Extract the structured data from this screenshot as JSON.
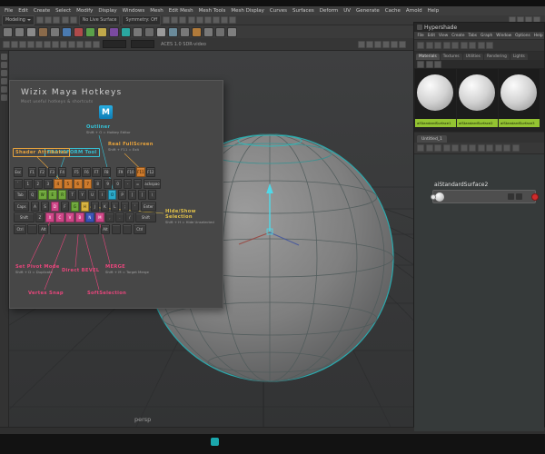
{
  "accent_colors": {
    "wireframe_teal": "#2aa9ad",
    "manipulator_cyan": "#4fd8e8",
    "swatch_label_green": "#93c332",
    "port_red": "#cf2b2b",
    "bottom_accent_teal": "#1ba7ad",
    "hotkey_cyan": "#35c1d6",
    "hotkey_orange": "#e8a33c",
    "hotkey_yellow": "#e3c248",
    "hotkey_magenta": "#e8467c"
  },
  "menubar": {
    "items": [
      "File",
      "Edit",
      "Create",
      "Select",
      "Modify",
      "Display",
      "Windows",
      "Mesh",
      "Edit Mesh",
      "Mesh Tools",
      "Mesh Display",
      "Curves",
      "Surfaces",
      "Deform",
      "UV",
      "Generate",
      "Cache",
      "Arnold",
      "Help"
    ]
  },
  "statusline": {
    "menu_set": "Modeling",
    "live_surface": "No Live Surface",
    "symmetry": "Symmetry: Off",
    "file_icons": [
      "new-scene-icon",
      "open-scene-icon",
      "save-scene-icon"
    ],
    "history_icons": [
      "undo-icon",
      "redo-icon"
    ],
    "mask_icons": [
      "select-hierarchy-icon",
      "select-object-icon",
      "select-component-icon"
    ],
    "snap_icons": [
      "snap-grid-icon",
      "snap-curve-icon",
      "snap-point-icon",
      "snap-projected-center-icon",
      "snap-view-plane-icon",
      "make-live-icon"
    ],
    "right_icons": [
      "construction-history-icon",
      "render-view-icon",
      "ipr-render-icon",
      "render-settings-icon"
    ]
  },
  "shelf": {
    "icons": [
      {
        "name": "poly-sphere-icon",
        "color": "#787878"
      },
      {
        "name": "poly-cube-icon",
        "color": "#787878"
      },
      {
        "name": "poly-cylinder-icon",
        "color": "#8a8a8a"
      },
      {
        "name": "poly-plane-icon",
        "color": "#8a6a4a"
      },
      {
        "name": "poly-torus-icon",
        "color": "#787878"
      },
      {
        "name": "poly-cone-icon",
        "color": "#4a7ab0"
      },
      {
        "name": "poly-disc-icon",
        "color": "#b04a4a"
      },
      {
        "name": "poly-gear-icon",
        "color": "#5aa04a"
      },
      {
        "name": "poly-soccerball-icon",
        "color": "#c0a84a"
      },
      {
        "name": "poly-platonic-icon",
        "color": "#7a4aa0"
      },
      {
        "name": "poly-superellipse-icon",
        "color": "#2aa7a0"
      },
      {
        "name": "poly-helix-icon",
        "color": "#787878"
      },
      {
        "name": "poly-pipe-icon",
        "color": "#6a6a6a"
      },
      {
        "name": "poly-prism-icon",
        "color": "#9a9a9a"
      },
      {
        "name": "poly-pyramid-icon",
        "color": "#6a8a9a"
      },
      {
        "name": "nurbs-sphere-icon",
        "color": "#787878"
      },
      {
        "name": "nurbs-cube-icon",
        "color": "#b07a3a"
      },
      {
        "name": "bevel-icon",
        "color": "#787878"
      },
      {
        "name": "extrude-icon",
        "color": "#6f6f6f"
      },
      {
        "name": "multi-cut-icon",
        "color": "#7f7f7f"
      }
    ]
  },
  "toolrow": {
    "icons": [
      "snap-magnets-icon",
      "grid-display-icon",
      "wireframe-mode-icon",
      "shaded-mode-icon",
      "textured-mode-icon",
      "use-all-lights-icon",
      "shadows-icon",
      "screen-space-ao-icon",
      "motion-blur-icon",
      "anti-aliasing-icon",
      "two-sided-lighting-icon",
      "isolate-select-icon"
    ],
    "colorspace": "ACES 1.0 SDR-video",
    "right_icons": [
      "camera-attributes-icon",
      "bookmarks-icon",
      "image-plane-icon",
      "field-chart-icon",
      "resolution-gate-icon",
      "gate-mask-icon"
    ]
  },
  "toolbox": {
    "icons": [
      "select-tool-icon",
      "lasso-tool-icon",
      "paint-select-tool-icon",
      "move-tool-icon",
      "rotate-tool-icon",
      "scale-tool-icon"
    ]
  },
  "viewport": {
    "camera_label": "persp"
  },
  "overlay": {
    "title": "Wizix Maya Hotkeys",
    "subtitle": "Most useful hotkeys & shortcuts",
    "logo_letter": "M",
    "annotations": [
      {
        "id": "outliner",
        "text": "Outliner",
        "sub": "Shift + O = Hotkey Editor",
        "color": "#35c1d6",
        "boxed": false
      },
      {
        "id": "transform",
        "text": "TRANSFORM Tool",
        "color": "#35c1d6",
        "boxed": true
      },
      {
        "id": "fullscreen",
        "text": "Real FullScreen",
        "sub": "Shift + F11 = Exit",
        "color": "#e8a33c",
        "boxed": false
      },
      {
        "id": "shader",
        "text": "Shader Attributes",
        "color": "#e8a33c",
        "boxed": true
      },
      {
        "id": "hide",
        "text": "Hide/Show Selection",
        "sub": "Shift + H = Hide Unselected",
        "color": "#e3c248",
        "boxed": false
      },
      {
        "id": "pivot",
        "text": "Set Pivot Mode",
        "sub": "Shift + D = Duplicate",
        "color": "#e8467c",
        "boxed": false
      },
      {
        "id": "bevel",
        "text": "Direct BEVEL",
        "color": "#e8467c",
        "boxed": false
      },
      {
        "id": "merge",
        "text": "MERGE",
        "sub": "Shift + M = Target Merge",
        "color": "#e8467c",
        "boxed": false
      },
      {
        "id": "vsnap",
        "text": "Vertex Snap",
        "color": "#e8467c",
        "boxed": false
      },
      {
        "id": "softsel",
        "text": "SoftSelection",
        "color": "#e8467c",
        "boxed": false
      }
    ],
    "keyboard": {
      "rows": [
        [
          [
            "Esc",
            1,
            ""
          ],
          [
            "",
            0.35,
            "sp"
          ],
          [
            "F1",
            1,
            ""
          ],
          [
            "F2",
            1,
            ""
          ],
          [
            "F3",
            1,
            ""
          ],
          [
            "F4",
            1,
            ""
          ],
          [
            "",
            0.35,
            "sp"
          ],
          [
            "F5",
            1,
            ""
          ],
          [
            "F6",
            1,
            ""
          ],
          [
            "F7",
            1,
            ""
          ],
          [
            "F8",
            1,
            ""
          ],
          [
            "",
            0.35,
            "sp"
          ],
          [
            "F9",
            1,
            ""
          ],
          [
            "F10",
            1,
            ""
          ],
          [
            "F11",
            1,
            "o"
          ],
          [
            "F12",
            1,
            ""
          ]
        ],
        [
          [
            "`",
            1,
            ""
          ],
          [
            "1",
            1,
            ""
          ],
          [
            "2",
            1,
            ""
          ],
          [
            "3",
            1,
            ""
          ],
          [
            "4",
            1,
            "o"
          ],
          [
            "5",
            1,
            "o"
          ],
          [
            "6",
            1,
            "o"
          ],
          [
            "7",
            1,
            "o"
          ],
          [
            "8",
            1,
            ""
          ],
          [
            "9",
            1,
            ""
          ],
          [
            "0",
            1,
            ""
          ],
          [
            "-",
            1,
            ""
          ],
          [
            "=",
            1,
            ""
          ],
          [
            "Backspace",
            1.85,
            ""
          ]
        ],
        [
          [
            "Tab",
            1.45,
            ""
          ],
          [
            "Q",
            1,
            ""
          ],
          [
            "W",
            1,
            "g"
          ],
          [
            "E",
            1,
            "g"
          ],
          [
            "R",
            1,
            "g"
          ],
          [
            "T",
            1,
            ""
          ],
          [
            "Y",
            1,
            ""
          ],
          [
            "U",
            1,
            ""
          ],
          [
            "I",
            1,
            ""
          ],
          [
            "O",
            1,
            "c"
          ],
          [
            "P",
            1,
            ""
          ],
          [
            "[",
            1,
            ""
          ],
          [
            "]",
            1,
            ""
          ],
          [
            "\\",
            1,
            ""
          ]
        ],
        [
          [
            "Caps",
            1.7,
            ""
          ],
          [
            "A",
            1,
            ""
          ],
          [
            "S",
            1,
            ""
          ],
          [
            "D",
            1,
            "m"
          ],
          [
            "F",
            1,
            ""
          ],
          [
            "G",
            1,
            "g"
          ],
          [
            "H",
            1,
            "y"
          ],
          [
            "J",
            1,
            ""
          ],
          [
            "K",
            1,
            ""
          ],
          [
            "L",
            1,
            ""
          ],
          [
            ";",
            1,
            ""
          ],
          [
            "'",
            1,
            ""
          ],
          [
            "Enter",
            1.75,
            ""
          ]
        ],
        [
          [
            "Shift",
            2.2,
            ""
          ],
          [
            "Z",
            1,
            ""
          ],
          [
            "X",
            1,
            "m"
          ],
          [
            "C",
            1,
            "m"
          ],
          [
            "V",
            1,
            "m"
          ],
          [
            "B",
            1,
            "m"
          ],
          [
            "N",
            1,
            "b"
          ],
          [
            "M",
            1,
            "m"
          ],
          [
            ",",
            1,
            ""
          ],
          [
            ".",
            1,
            ""
          ],
          [
            "/",
            1,
            ""
          ],
          [
            "Shift",
            2.2,
            ""
          ]
        ],
        [
          [
            "Ctrl",
            1.4,
            ""
          ],
          [
            "",
            1.1,
            ""
          ],
          [
            "Alt",
            1.1,
            ""
          ],
          [
            "",
            5.1,
            ""
          ],
          [
            "Alt",
            1.1,
            ""
          ],
          [
            "",
            1.1,
            ""
          ],
          [
            "",
            1.1,
            ""
          ],
          [
            "Ctrl",
            1.4,
            ""
          ]
        ]
      ]
    }
  },
  "hypershade": {
    "title": "Hypershade",
    "menus": [
      "File",
      "Edit",
      "View",
      "Create",
      "Tabs",
      "Graph",
      "Window",
      "Options",
      "Help"
    ],
    "toolbar_icons": [
      "create-node-icon",
      "sort-name-icon",
      "sort-type-icon",
      "sort-time-icon",
      "swatch-view-icon",
      "list-view-icon",
      "filter-materials-icon",
      "search-icon",
      "pin-browser-icon"
    ],
    "browser_tabs": [
      "Materials",
      "Textures",
      "Utilities",
      "Rendering",
      "Lights"
    ],
    "browser_bar_icons": [
      "filter-icon",
      "search-field-icon",
      "swatch-size-icon"
    ],
    "swatches": [
      "aiStandardSurface1",
      "aiStandardSurface2",
      "aiStandardSurface3"
    ],
    "work_tab": "Untitled_1",
    "node_toolbar_icons": [
      "input-connections-icon",
      "input-output-connections-icon",
      "output-connections-icon",
      "add-to-graph-icon",
      "remove-from-graph-icon",
      "clear-graph-icon",
      "rearrange-graph-icon",
      "additive-graph-icon",
      "pin-selected-icon",
      "zoom-in-icon",
      "zoom-out-icon",
      "frame-all-icon"
    ],
    "node": {
      "name": "aiStandardSurface2"
    }
  },
  "bottombar": {
    "icons": [
      "teal-app-icon"
    ]
  }
}
